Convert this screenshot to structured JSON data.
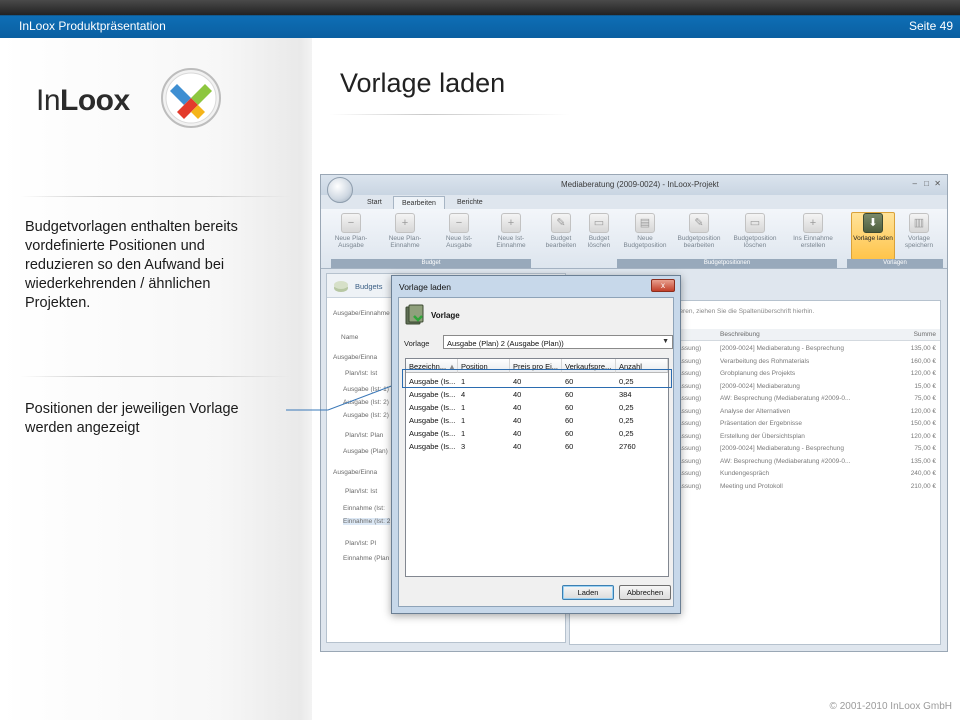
{
  "header": {
    "title": "InLoox Produktpräsentation",
    "page": "Seite 49"
  },
  "logo": {
    "word_light": "In",
    "word_bold": "Loox"
  },
  "slide": {
    "title": "Vorlage laden",
    "text1": "Budgetvorlagen enthalten bereits vordefinierte Positionen und reduzieren so den Aufwand bei wiederkehrenden / ähnlichen Projekten.",
    "text2": "Positionen der jeweiligen Vorlage werden angezeigt"
  },
  "app": {
    "window_title": "Mediaberatung (2009-0024) - InLoox-Projekt",
    "tabs": [
      "Start",
      "Bearbeiten",
      "Berichte"
    ],
    "ribbon_buttons": [
      "Neue Plan-Ausgabe",
      "Neue Plan-Einnahme",
      "Neue Ist-Ausgabe",
      "Neue Ist-Einnahme",
      "Budget bearbeiten",
      "Budget löschen",
      "Neue Budgetposition",
      "Budgetposition bearbeiten",
      "Budgetposition löschen",
      "Ins Einnahme erstellen",
      "Vorlage laden",
      "Vorlage speichern"
    ],
    "ribbon_groups": [
      "Budget",
      "Budgetpositionen",
      "Vorlagen"
    ],
    "left_pane": {
      "header": "Budgets",
      "filter": "Ausgabe/Einnahme",
      "col": "Name",
      "rows": [
        "Ausgabe/Einna",
        "Plan/Ist: Ist",
        "Ausgabe (Ist: 1)",
        "Ausgabe (Ist: 2)",
        "Ausgabe (Ist: 2)",
        "Plan/Ist: Plan",
        "Ausgabe (Plan)",
        "Ausgabe/Einna",
        "Plan/Ist: Ist",
        "Einnahme (Ist:",
        "Einnahme (Ist: 2",
        "Plan/Ist: Pl",
        "Einnahme (Plan"
      ]
    },
    "right_pane": {
      "hint": "ieren, ziehen Sie die Spaltenüberschrift hierhin.",
      "columns": [
        "Beschreibung",
        "Summe"
      ],
      "rows": [
        {
          "a": "assung)",
          "desc": "[2009-0024] Mediaberatung - Besprechung",
          "sum": "135,00 €"
        },
        {
          "a": "assung)",
          "desc": "Verarbeitung des Rohmaterials",
          "sum": "160,00 €"
        },
        {
          "a": "assung)",
          "desc": "Grobplanung des Projekts",
          "sum": "120,00 €"
        },
        {
          "a": "assung)",
          "desc": "[2009-0024] Mediaberatung",
          "sum": "15,00 €"
        },
        {
          "a": "assung)",
          "desc": "AW: Besprechung (Mediaberatung #2009-0...",
          "sum": "75,00 €"
        },
        {
          "a": "assung)",
          "desc": "Analyse der Alternativen",
          "sum": "120,00 €"
        },
        {
          "a": "assung)",
          "desc": "Präsentation der Ergebnisse",
          "sum": "150,00 €"
        },
        {
          "a": "assung)",
          "desc": "Erstellung der Übersichtsplan",
          "sum": "120,00 €"
        },
        {
          "a": "assung)",
          "desc": "[2009-0024] Mediaberatung - Besprechung",
          "sum": "75,00 €"
        },
        {
          "a": "assung)",
          "desc": "AW: Besprechung (Mediaberatung #2009-0...",
          "sum": "135,00 €"
        },
        {
          "a": "assung)",
          "desc": "Kundengespräch",
          "sum": "240,00 €"
        },
        {
          "a": "assung)",
          "desc": "Meeting und Protokoll",
          "sum": "210,00 €"
        }
      ]
    }
  },
  "dialog": {
    "title": "Vorlage laden",
    "close": "x",
    "heading": "Vorlage",
    "select_label": "Vorlage",
    "select_value": "Ausgabe (Plan) 2 (Ausgabe (Plan))",
    "columns": [
      "Bezeichn...",
      "Position",
      "Preis pro Ei...",
      "Verkaufspre...",
      "Anzahl"
    ],
    "rows": [
      [
        "Ausgabe (Is...",
        "1",
        "40",
        "60",
        "0,25"
      ],
      [
        "Ausgabe (Is...",
        "4",
        "40",
        "60",
        "384"
      ],
      [
        "Ausgabe (Is...",
        "1",
        "40",
        "60",
        "0,25"
      ],
      [
        "Ausgabe (Is...",
        "1",
        "40",
        "60",
        "0,25"
      ],
      [
        "Ausgabe (Is...",
        "1",
        "40",
        "60",
        "0,25"
      ],
      [
        "Ausgabe (Is...",
        "3",
        "40",
        "60",
        "2760"
      ]
    ],
    "load_button": "Laden",
    "cancel_button": "Abbrechen"
  },
  "footer": "© 2001-2010 InLoox GmbH"
}
